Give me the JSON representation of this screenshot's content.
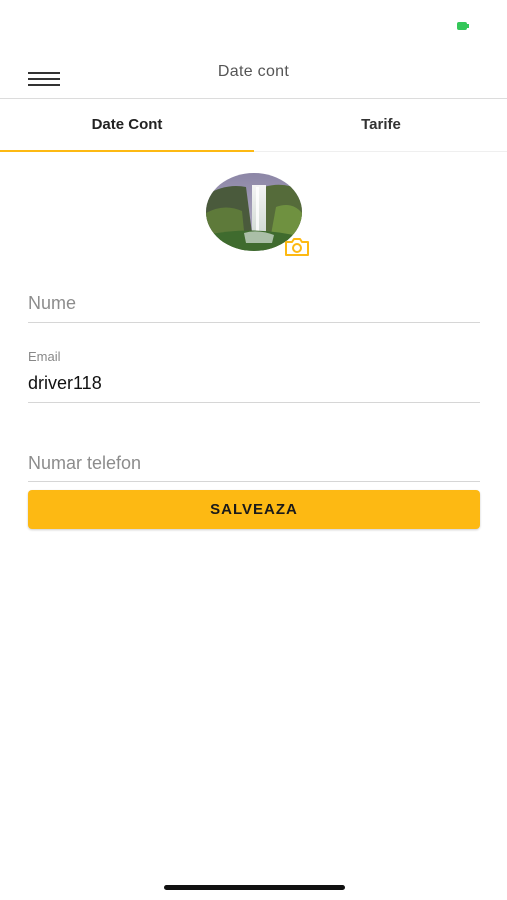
{
  "colors": {
    "accent": "#fdb913",
    "battery": "#34c759"
  },
  "status_bar": {
    "battery_icon": "battery-icon"
  },
  "header": {
    "menu_icon": "hamburger-menu-icon",
    "title": "Date cont"
  },
  "tabs": [
    {
      "label": "Date Cont",
      "active": true
    },
    {
      "label": "Tarife",
      "active": false
    }
  ],
  "profile": {
    "avatar_icon": "avatar-waterfall-photo",
    "camera_icon": "camera-icon"
  },
  "form": {
    "name": {
      "placeholder": "Nume",
      "value": ""
    },
    "email": {
      "label": "Email",
      "value": "driver118"
    },
    "phone": {
      "placeholder": "Numar telefon",
      "value": ""
    },
    "save_label": "SALVEAZA"
  }
}
